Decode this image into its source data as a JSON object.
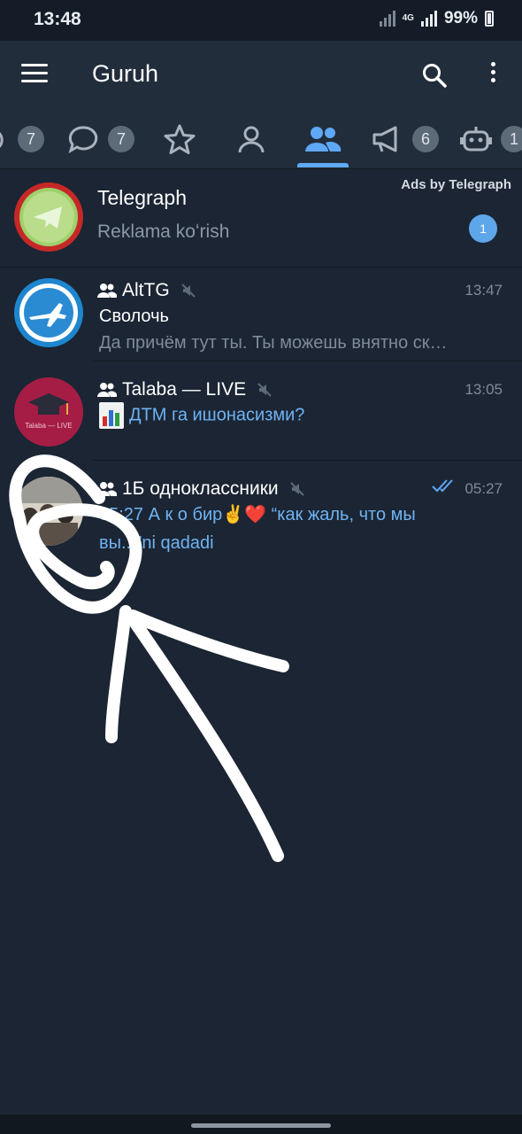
{
  "status_bar": {
    "time": "13:48",
    "network": "4G",
    "battery": "99%"
  },
  "app_bar": {
    "title": "Guruh",
    "icons": [
      "menu-icon",
      "search-icon",
      "more-vert-icon"
    ]
  },
  "tabs": [
    {
      "name": "tab-all-chats",
      "icon": "chat-icon",
      "badge": "7"
    },
    {
      "name": "tab-unread",
      "icon": "chat-bubble-icon",
      "badge": "7"
    },
    {
      "name": "tab-favorites",
      "icon": "star-icon",
      "badge": ""
    },
    {
      "name": "tab-contacts",
      "icon": "person-icon",
      "badge": ""
    },
    {
      "name": "tab-groups",
      "icon": "group-icon",
      "badge": "",
      "active": true
    },
    {
      "name": "tab-channels",
      "icon": "megaphone-icon",
      "badge": "6"
    },
    {
      "name": "tab-bots",
      "icon": "bot-icon",
      "badge": "1"
    }
  ],
  "ad": {
    "label": "Ads by Telegraph",
    "name": "Telegraph",
    "subtitle": "Reklama koʻrish",
    "badge": "1"
  },
  "chats": [
    {
      "name": "AltTG",
      "time": "13:47",
      "line1": "Сволочь",
      "line2": "Да причём тут ты. Ты можешь внятно ск…"
    },
    {
      "name": "Talaba — LIVE",
      "time": "13:05",
      "line1": "ДТМ га ишонасизми?",
      "avatar_text": "Talaba — LIVE"
    },
    {
      "name": "1Б одноклассники",
      "time": "05:27",
      "line1": "05:27 А к о бир✌️❤️ “как жаль, что мы",
      "line2": "вы...”ni qadadi"
    }
  ],
  "colors": {
    "background": "#1b2533",
    "bar": "#212d3b",
    "accent": "#5fa8f5"
  }
}
